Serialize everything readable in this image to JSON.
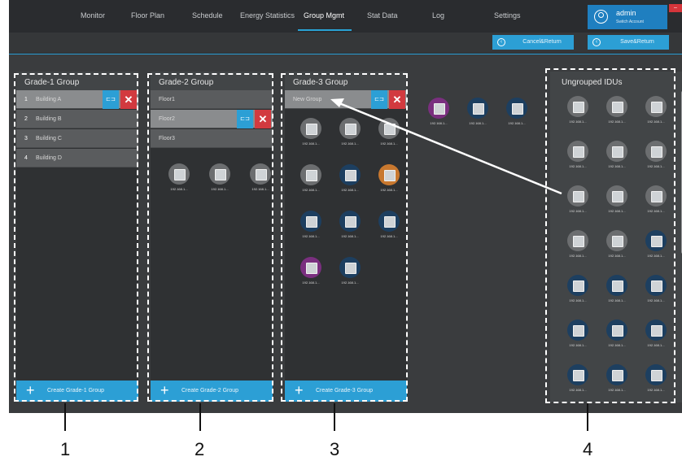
{
  "nav": {
    "items": [
      "Monitor",
      "Floor Plan",
      "Schedule",
      "Energy Statistics",
      "Group Mgmt",
      "Stat Data",
      "Log",
      "Settings"
    ],
    "active": "Group Mgmt"
  },
  "user": {
    "name": "admin",
    "subtitle": "Switch Account"
  },
  "actions": {
    "cancel": "Cancel&Return",
    "save": "Save&Return",
    "cancel_icon": "arrow-circle-icon",
    "save_icon": "arrow-circle-icon"
  },
  "grade1": {
    "title": "Grade-1 Group",
    "items": [
      {
        "num": "1",
        "label": "Building A",
        "selected": true
      },
      {
        "num": "2",
        "label": "Building B"
      },
      {
        "num": "3",
        "label": "Building C"
      },
      {
        "num": "4",
        "label": "Building D"
      }
    ],
    "create_label": "Create Grade-1 Group"
  },
  "grade2": {
    "title": "Grade-2 Group",
    "items": [
      {
        "label": "Floor1"
      },
      {
        "label": "Floor2",
        "selected": true
      },
      {
        "label": "Floor3"
      }
    ],
    "devices": [
      "192.168.1...",
      "192.168.1...",
      "192.168.1..."
    ],
    "create_label": "Create Grade-2 Group"
  },
  "grade3": {
    "title": "Grade-3 Group",
    "items": [
      {
        "label": "New Group",
        "selected": true
      }
    ],
    "devices": [
      {
        "ip": "192.168.1...",
        "color": "gray"
      },
      {
        "ip": "192.168.1...",
        "color": "gray"
      },
      {
        "ip": "192.168.1...",
        "color": "gray"
      },
      {
        "ip": "192.168.1...",
        "color": "gray"
      },
      {
        "ip": "192.168.1...",
        "color": "blue"
      },
      {
        "ip": "192.168.1...",
        "color": "orange"
      },
      {
        "ip": "192.168.1...",
        "color": "blue"
      },
      {
        "ip": "192.168.1...",
        "color": "blue"
      },
      {
        "ip": "192.168.1...",
        "color": "blue"
      },
      {
        "ip": "192.168.1...",
        "color": "purple"
      },
      {
        "ip": "192.168.1...",
        "color": "blue"
      }
    ],
    "create_label": "Create Grade-3 Group"
  },
  "loose_devices": [
    {
      "ip": "192.168.1...",
      "color": "purple"
    },
    {
      "ip": "192.168.1...",
      "color": "blue"
    },
    {
      "ip": "192.168.1...",
      "color": "blue"
    }
  ],
  "ungrouped": {
    "title": "Ungrouped IDUs",
    "devices": [
      {
        "ip": "192.168.1...",
        "color": "gray"
      },
      {
        "ip": "192.168.1...",
        "color": "gray"
      },
      {
        "ip": "192.168.1...",
        "color": "gray"
      },
      {
        "ip": "192.168.1...",
        "color": "gray"
      },
      {
        "ip": "192.168.1...",
        "color": "gray"
      },
      {
        "ip": "192.168.1...",
        "color": "gray"
      },
      {
        "ip": "192.168.1...",
        "color": "gray"
      },
      {
        "ip": "192.168.1...",
        "color": "gray"
      },
      {
        "ip": "192.168.1...",
        "color": "gray"
      },
      {
        "ip": "192.168.1...",
        "color": "gray"
      },
      {
        "ip": "192.168.1...",
        "color": "gray"
      },
      {
        "ip": "192.168.1...",
        "color": "blue"
      },
      {
        "ip": "192.168.1...",
        "color": "blue"
      },
      {
        "ip": "192.168.1...",
        "color": "blue"
      },
      {
        "ip": "192.168.1...",
        "color": "blue"
      },
      {
        "ip": "192.168.1...",
        "color": "blue"
      },
      {
        "ip": "192.168.1...",
        "color": "blue"
      },
      {
        "ip": "192.168.1...",
        "color": "blue"
      },
      {
        "ip": "192.168.1...",
        "color": "blue"
      },
      {
        "ip": "192.168.1...",
        "color": "blue"
      },
      {
        "ip": "192.168.1...",
        "color": "blue"
      }
    ]
  },
  "callouts": [
    "1",
    "2",
    "3",
    "4"
  ],
  "colors": {
    "accent": "#2c9fd5",
    "danger": "#d23a3f",
    "panel": "#424547",
    "background": "#2e3032"
  }
}
